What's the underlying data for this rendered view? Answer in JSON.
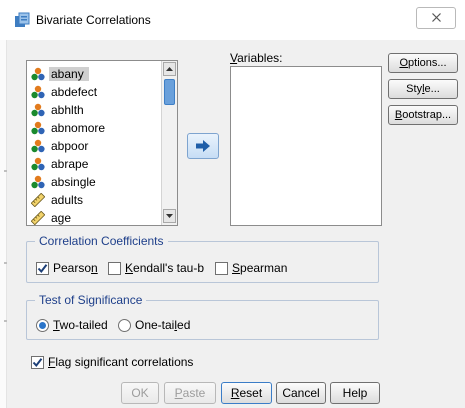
{
  "window": {
    "title": "Bivariate Correlations"
  },
  "source_list": {
    "items": [
      {
        "label": "abany",
        "icon": "nominal-variable-icon",
        "selected": true
      },
      {
        "label": "abdefect",
        "icon": "nominal-variable-icon"
      },
      {
        "label": "abhlth",
        "icon": "nominal-variable-icon"
      },
      {
        "label": "abnomore",
        "icon": "nominal-variable-icon"
      },
      {
        "label": "abpoor",
        "icon": "nominal-variable-icon"
      },
      {
        "label": "abrape",
        "icon": "nominal-variable-icon"
      },
      {
        "label": "absingle",
        "icon": "nominal-variable-icon"
      },
      {
        "label": "adults",
        "icon": "scale-variable-icon"
      },
      {
        "label": "age",
        "icon": "scale-variable-icon"
      }
    ]
  },
  "target": {
    "label_pre": "",
    "label_u": "V",
    "label_post": "ariables:"
  },
  "side_buttons": {
    "options": {
      "pre": "",
      "u": "O",
      "post": "ptions..."
    },
    "style": {
      "pre": "Sty",
      "u": "l",
      "post": "e..."
    },
    "bootstrap": {
      "pre": "",
      "u": "B",
      "post": "ootstrap..."
    }
  },
  "correlation": {
    "title": "Correlation Coefficients",
    "pearson": {
      "pre": "Pearso",
      "u": "n",
      "post": "",
      "checked": true
    },
    "kendall": {
      "pre": "",
      "u": "K",
      "post": "endall's tau-b",
      "checked": false
    },
    "spearman": {
      "pre": "",
      "u": "S",
      "post": "pearman",
      "checked": false
    }
  },
  "significance": {
    "title": "Test of Significance",
    "two_tailed": {
      "pre": "",
      "u": "T",
      "post": "wo-tailed",
      "selected": true
    },
    "one_tailed": {
      "pre": "One-tai",
      "u": "l",
      "post": "ed",
      "selected": false
    }
  },
  "flag": {
    "pre": "",
    "u": "F",
    "post": "lag significant correlations",
    "checked": true
  },
  "bottom_buttons": {
    "ok": "OK",
    "paste": {
      "pre": "",
      "u": "P",
      "post": "aste"
    },
    "reset": {
      "pre": "",
      "u": "R",
      "post": "eset"
    },
    "cancel": "Cancel",
    "help": "Help"
  },
  "colors": {
    "accent": "#2a74c9",
    "group_title": "#1e3f8a"
  }
}
